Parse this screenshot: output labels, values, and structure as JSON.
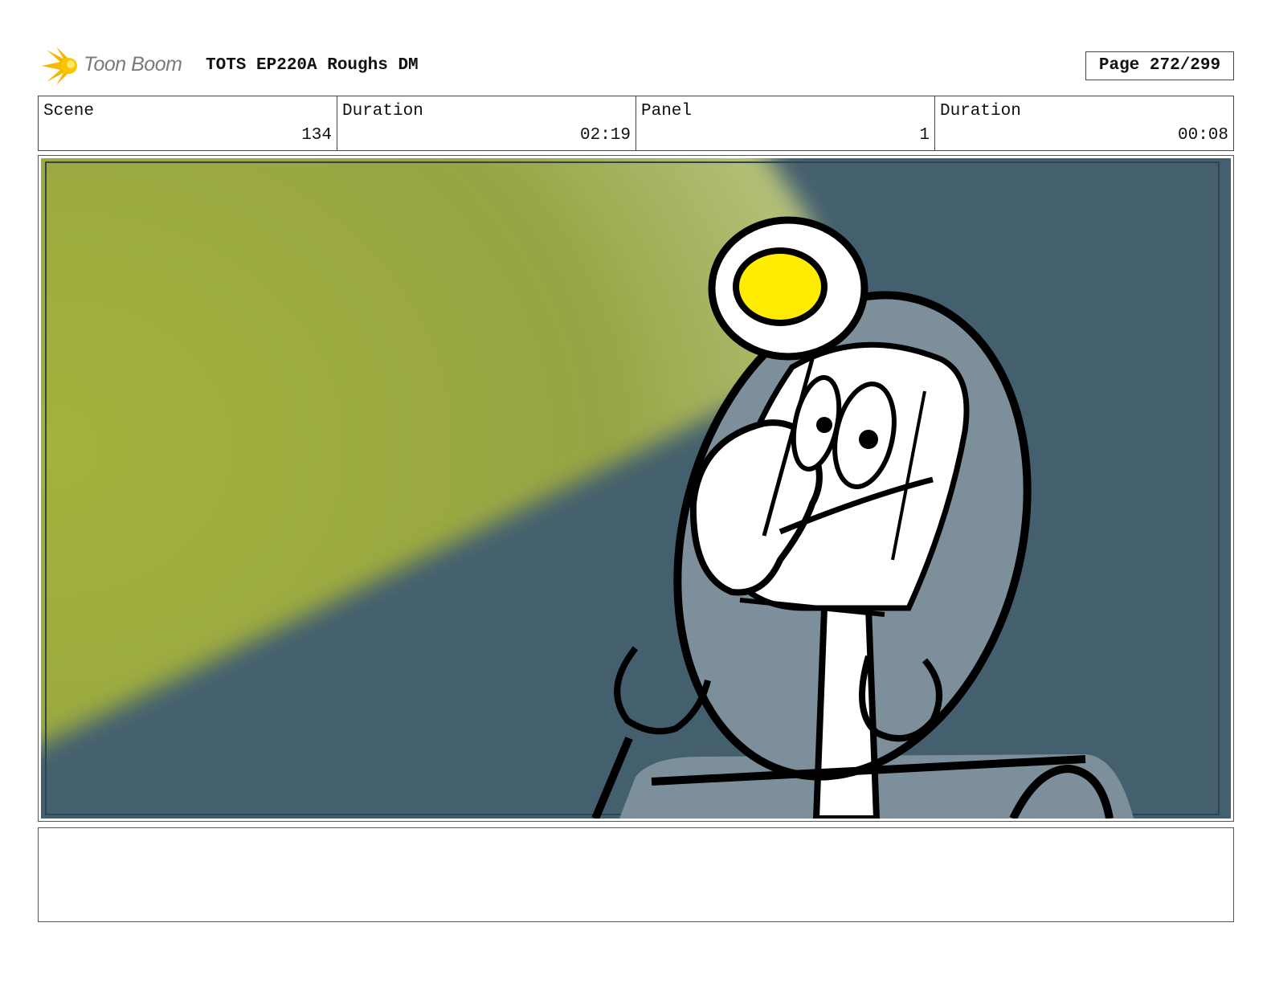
{
  "header": {
    "logo_text": "Toon Boom",
    "title": "TOTS EP220A Roughs DM",
    "page": "Page 272/299"
  },
  "info": {
    "scene_label": "Scene",
    "scene_value": "134",
    "scene_duration_label": "Duration",
    "scene_duration_value": "02:19",
    "panel_label": "Panel",
    "panel_value": "1",
    "panel_duration_label": "Duration",
    "panel_duration_value": "00:08"
  },
  "colors": {
    "spotlight": "#a3b23a",
    "background": "#44606f",
    "helmet_glass": "#7c8f9a",
    "lamp": "#ffec00"
  },
  "notes": ""
}
